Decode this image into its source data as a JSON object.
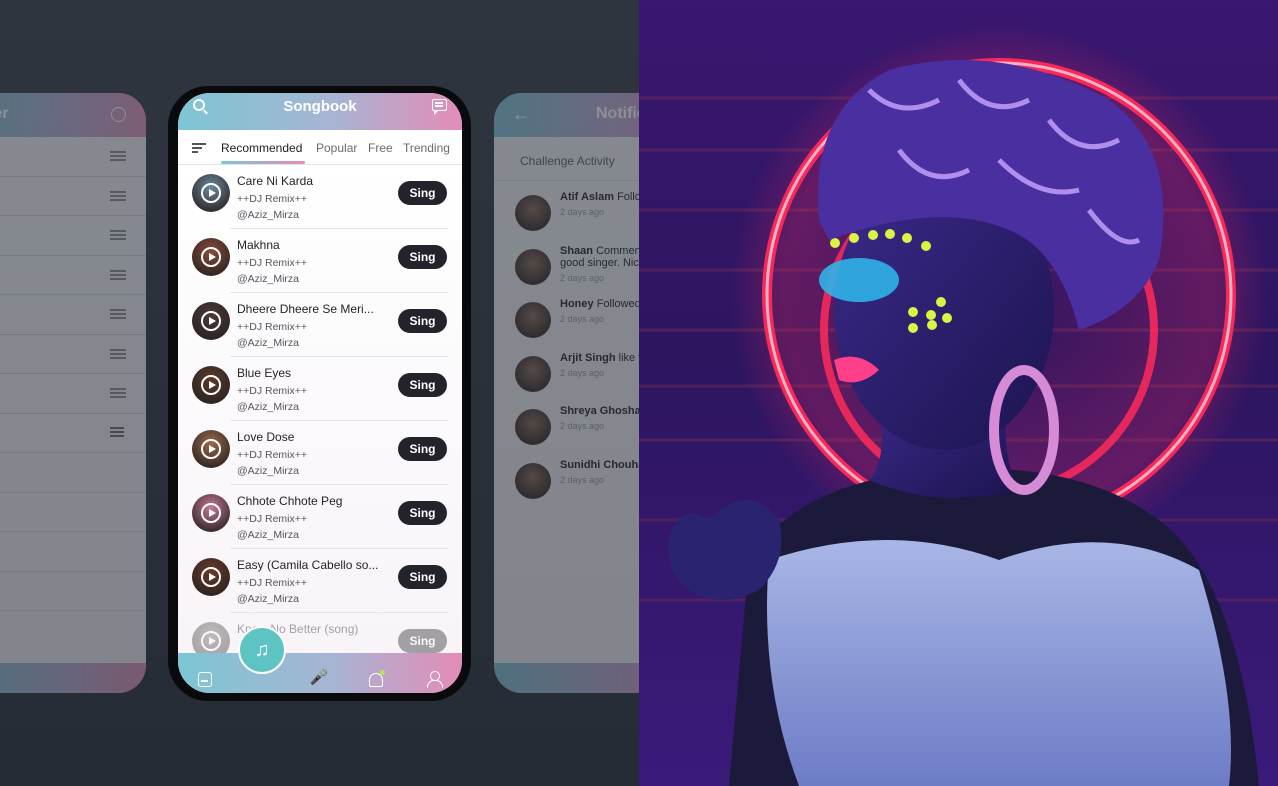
{
  "left_ghost": {
    "title": "ter"
  },
  "phone": {
    "app_title": "Songbook",
    "tabs": [
      {
        "label": "Recommended"
      },
      {
        "label": "Popular"
      },
      {
        "label": "Free"
      },
      {
        "label": "Trending"
      }
    ],
    "sing_label": "Sing",
    "songs": [
      {
        "name": "Care Ni Karda",
        "remix": "++DJ Remix++",
        "user": "@Aziz_Mirza",
        "thumb_color": "#6a8aa0"
      },
      {
        "name": "Makhna",
        "remix": "++DJ Remix++",
        "user": "@Aziz_Mirza",
        "thumb_color": "#8a4a3a"
      },
      {
        "name": "Dheere Dheere Se Meri...",
        "remix": "++DJ Remix++",
        "user": "@Aziz_Mirza",
        "thumb_color": "#4a3a3a"
      },
      {
        "name": "Blue Eyes",
        "remix": "++DJ Remix++",
        "user": "@Aziz_Mirza",
        "thumb_color": "#5a3a2a"
      },
      {
        "name": "Love Dose",
        "remix": "++DJ Remix++",
        "user": "@Aziz_Mirza",
        "thumb_color": "#9a6a4a"
      },
      {
        "name": "Chhote Chhote Peg",
        "remix": "++DJ Remix++",
        "user": "@Aziz_Mirza",
        "thumb_color": "#c87a9a"
      },
      {
        "name": "Easy (Camila Cabello so...",
        "remix": "++DJ Remix++",
        "user": "@Aziz_Mirza",
        "thumb_color": "#6a3a2a"
      },
      {
        "name": "Know No Better (song)",
        "remix": "",
        "user": "",
        "thumb_color": "#6a6a6a"
      }
    ]
  },
  "right_ghost": {
    "title": "Notific",
    "tab": "Challenge Activity",
    "items": [
      {
        "name": "Atif Aslam",
        "text": "Follo",
        "time": "2 days ago"
      },
      {
        "name": "Shaan",
        "text": "Commen",
        "line2": "good singer. Nic",
        "time": "2 days ago"
      },
      {
        "name": "Honey",
        "text": "Followed",
        "time": "2 days ago"
      },
      {
        "name": "Arjit Singh",
        "text": "like y",
        "time": "2 days ago"
      },
      {
        "name": "Shreya Ghoshal",
        "text": "",
        "time": "2 days ago"
      },
      {
        "name": "Sunidhi Chouha",
        "text": "",
        "time": "2 days ago"
      }
    ]
  },
  "colors": {
    "background": "#2b323b",
    "gradient_start": "#7cc6d3",
    "gradient_end": "#e38cb7",
    "button": "#23232b",
    "fab": "#5ec3c3",
    "neon_ring": "#ff2a5a"
  }
}
